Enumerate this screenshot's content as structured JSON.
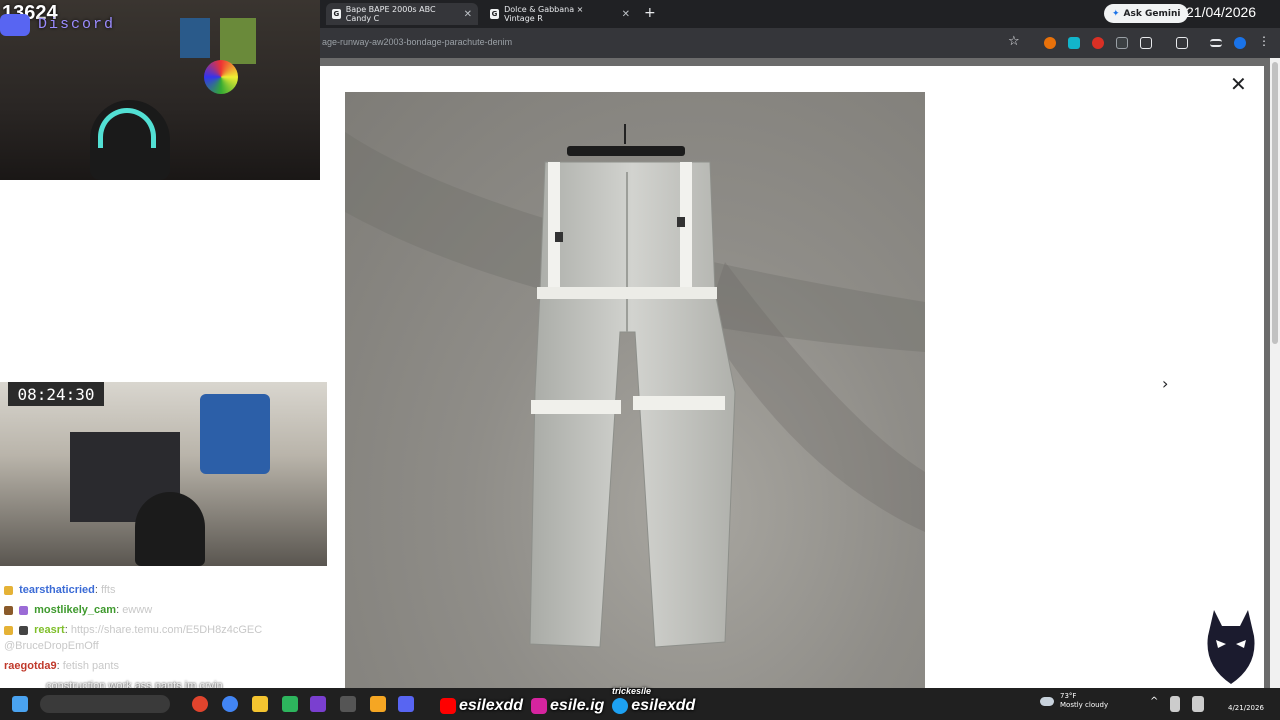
{
  "overlay": {
    "stream_count": "13624",
    "discord_label": "Discord",
    "timer": "08:24:30"
  },
  "browser": {
    "tabs": [
      {
        "title": "Bape BAPE 2000s ABC Candy C",
        "favicon": "G",
        "active": true
      },
      {
        "title": "Dolce & Gabbana × Vintage R",
        "favicon": "G",
        "active": false
      }
    ],
    "ask_gemini": "Ask Gemini",
    "date_overlay": "21/04/2026",
    "url": "age-runway-aw2003-bondage-parachute-denim"
  },
  "viewer": {
    "image_subject": "light grey bondage parachute denim pants hanging on concrete wall",
    "close_icon": "close-icon",
    "next_icon": "chevron-right-icon"
  },
  "chat": {
    "messages": [
      {
        "user": "tearsthaticried",
        "msg": "ffts",
        "color": "#6ea8ff"
      },
      {
        "user": "mostlikely_cam",
        "msg": "ewww",
        "color": "#7ed957"
      },
      {
        "user": "reasrt",
        "msg": "https://share.temu.com/E5DH8z4cGEC",
        "color": "#9fd44b"
      },
      {
        "user": "",
        "msg": "@BruceDropEmOff",
        "color": "#c8c8c8"
      },
      {
        "user": "raegotda9",
        "msg": "fetish pants",
        "color": "#ff6b6b"
      },
      {
        "user": "",
        "msg": "construction work ass pants im cryin",
        "color": "#c8c8c8"
      }
    ]
  },
  "taskbar": {
    "socials": [
      {
        "handle": "esilexdd",
        "icon": "youtube-icon",
        "color": "#ff0000"
      },
      {
        "handle": "esile.ig",
        "icon": "instagram-icon",
        "color": "#d6249f"
      },
      {
        "handle": "esilexdd",
        "icon": "twitter-icon",
        "color": "#1da1f2"
      }
    ],
    "socials_caption": "trickesile",
    "weather_temp": "73°F",
    "weather_desc": "Mostly cloudy",
    "tray_date": "4/21/2026"
  }
}
